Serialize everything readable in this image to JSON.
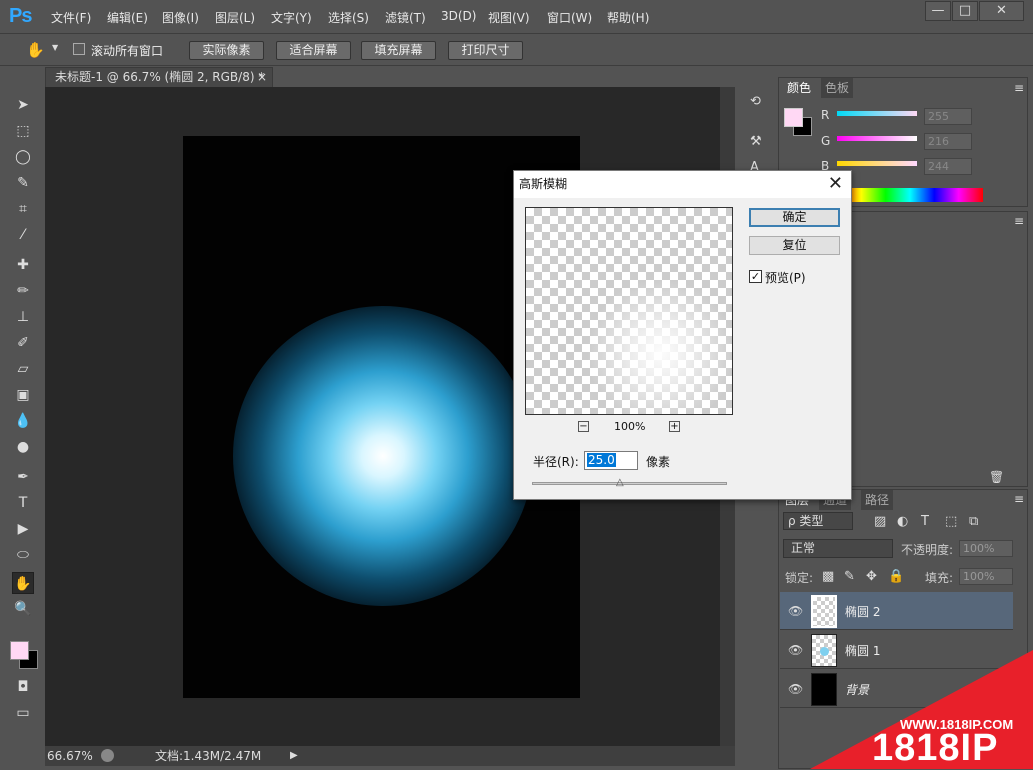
{
  "app": {
    "logo": "Ps"
  },
  "menu": [
    "文件(F)",
    "编辑(E)",
    "图像(I)",
    "图层(L)",
    "文字(Y)",
    "选择(S)",
    "滤镜(T)",
    "3D(D)",
    "视图(V)",
    "窗口(W)",
    "帮助(H)"
  ],
  "window_controls": {
    "minimize": "—",
    "maximize": "□",
    "close": "✕"
  },
  "options_bar": {
    "scroll_all_label": "滚动所有窗口",
    "buttons": [
      "实际像素",
      "适合屏幕",
      "填充屏幕",
      "打印尺寸"
    ]
  },
  "document": {
    "tab_title": "未标题-1 @ 66.7% (椭圆 2, RGB/8) *",
    "tab_close": "×"
  },
  "status": {
    "zoom": "66.67%",
    "doc_info": "文档:1.43M/2.47M"
  },
  "color_panel": {
    "tabs": [
      "颜色",
      "色板"
    ],
    "channels": [
      {
        "label": "R",
        "value": "255"
      },
      {
        "label": "G",
        "value": "216"
      },
      {
        "label": "B",
        "value": "244"
      }
    ],
    "foreground": "#ffd8f4"
  },
  "layers_panel": {
    "tabs": [
      "图层",
      "通道",
      "路径"
    ],
    "filter_kind": "ρ 类型",
    "blend_mode": "正常",
    "opacity_label": "不透明度:",
    "opacity_value": "100%",
    "lock_label": "锁定:",
    "fill_label": "填充:",
    "fill_value": "100%",
    "layers": [
      {
        "name": "椭圆 2"
      },
      {
        "name": "椭圆 1"
      },
      {
        "name": "背景"
      }
    ]
  },
  "dialog": {
    "title": "高斯模糊",
    "close": "✕",
    "zoom_out": "−",
    "zoom_level": "100%",
    "zoom_in": "+",
    "ok": "确定",
    "reset": "复位",
    "preview_label": "预览(P)",
    "radius_label": "半径(R):",
    "radius_value": "25.0",
    "radius_unit": "像素"
  },
  "watermark": {
    "url": "WWW.1818IP.COM",
    "brand": "1818IP"
  }
}
